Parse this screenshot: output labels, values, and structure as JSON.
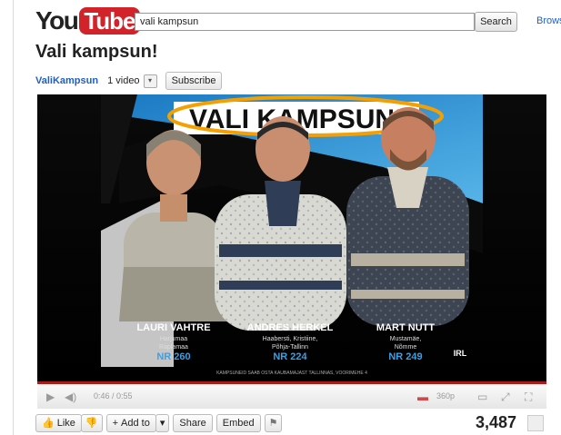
{
  "header": {
    "logo_you": "You",
    "logo_tube": "Tube",
    "search_value": "vali kampsun",
    "search_button": "Search",
    "browse_label": "Browse"
  },
  "video": {
    "title": "Vali kampsun!",
    "channel": "ValiKampsun",
    "video_count": "1 video",
    "subscribe": "Subscribe",
    "banner": "VALI KAMPSUN!",
    "candidates": [
      {
        "name": "LAURI VAHTRE",
        "area1": "Harjumaa",
        "area2": "Raplamaa",
        "number": "NR 260"
      },
      {
        "name": "ANDRES HERKEL",
        "area1": "Haabersti, Kristiine,",
        "area2": "Põhja-Tallinn",
        "number": "NR 224"
      },
      {
        "name": "MART NUTT",
        "area1": "Mustamäe,",
        "area2": "Nõmme",
        "number": "NR 249"
      }
    ],
    "footer_caption": "KAMPSUNEID SAAB OSTA KAUBAMAJAST TALLINNAS, VOORIMEHE 4",
    "party": "IRL"
  },
  "player": {
    "time": "0:46 / 0:55",
    "quality": "360p"
  },
  "actions": {
    "like": "Like",
    "add_to": "Add to",
    "share": "Share",
    "embed": "Embed",
    "views": "3,487"
  }
}
